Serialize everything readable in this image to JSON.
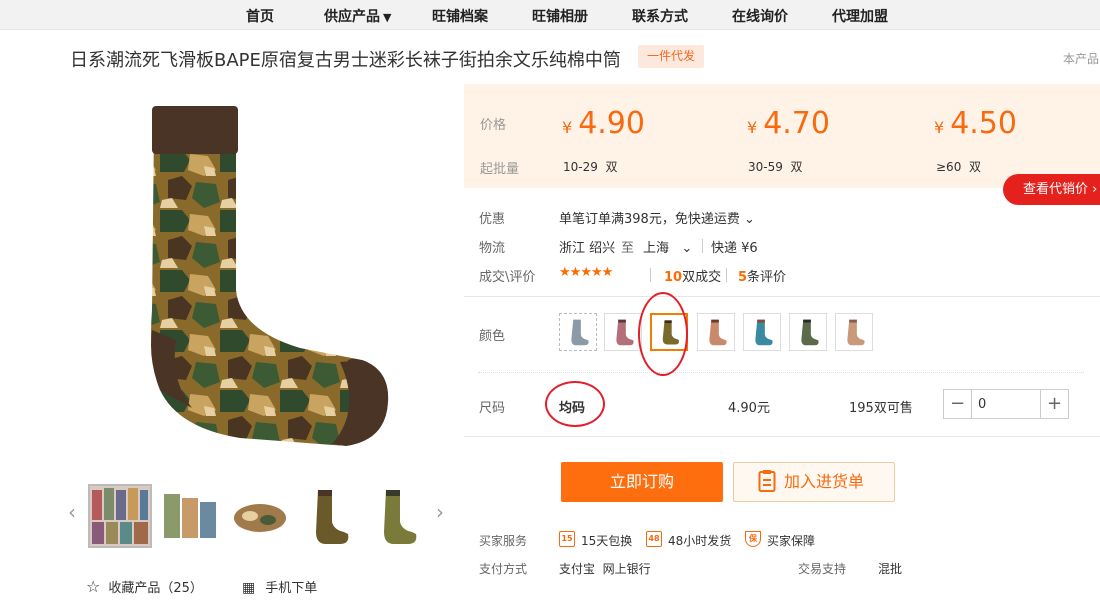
{
  "nav": {
    "items": [
      {
        "label": "首页"
      },
      {
        "label": "供应产品",
        "caret": "▼"
      },
      {
        "label": "旺铺档案"
      },
      {
        "label": "旺铺相册"
      },
      {
        "label": "联系方式"
      },
      {
        "label": "在线询价"
      },
      {
        "label": "代理加盟"
      }
    ]
  },
  "product": {
    "title": "日系潮流死飞滑板BAPE原宿复古男士迷彩长袜子街拍余文乐纯棉中筒",
    "badge": "一件代发",
    "title_right": "本产品"
  },
  "gallery": {
    "prev_icon": "chevron-left-icon",
    "next_icon": "chevron-right-icon"
  },
  "actions": {
    "favorite_label": "收藏产品（25）",
    "mobile_order_label": "手机下单"
  },
  "pricing": {
    "price_label": "价格",
    "qty_label": "起批量",
    "currency": "¥",
    "unit": "双",
    "tiers": [
      {
        "price": "4.90",
        "range": "10-29"
      },
      {
        "price": "4.70",
        "range": "30-59"
      },
      {
        "price": "4.50",
        "range": "≥60"
      }
    ],
    "agent_price_label": "查看代销价 ›"
  },
  "info": {
    "discount_label": "优惠",
    "discount_text": "单笔订单满398元，免快递运费",
    "discount_caret": "⌄",
    "shipping_label": "物流",
    "ship_from": "浙江 绍兴",
    "ship_to_word": "至",
    "ship_to": "上海",
    "ship_caret": "⌄",
    "ship_method": "快递 ¥6",
    "deals_label": "成交\\评价",
    "rating": 4.5,
    "deal_count": "10",
    "deal_suffix": "双成交",
    "review_count": "5",
    "review_suffix": "条评价"
  },
  "colors": {
    "label": "颜色",
    "selected_index": 2
  },
  "size": {
    "label": "尺码",
    "value": "均码",
    "price": "4.90元",
    "stock": "195双可售",
    "quantity": "0"
  },
  "buttons": {
    "buy_label": "立即订购",
    "cart_label": "加入进货单"
  },
  "services": {
    "buyer_label": "买家服务",
    "items": [
      {
        "icon": "15",
        "label": "15天包换"
      },
      {
        "icon": "48",
        "label": "48小时发货"
      },
      {
        "icon": "保",
        "label": "买家保障"
      }
    ],
    "payment_label": "支付方式",
    "payment_methods": "支付宝  网上银行",
    "trade_label": "交易支持",
    "trade_value": "混批"
  },
  "colors_palette": {
    "brand_orange": "#ff6e0e",
    "price_orange": "#f76a10",
    "panel_bg": "#fff3e8",
    "annotation_red": "#e0202b"
  }
}
